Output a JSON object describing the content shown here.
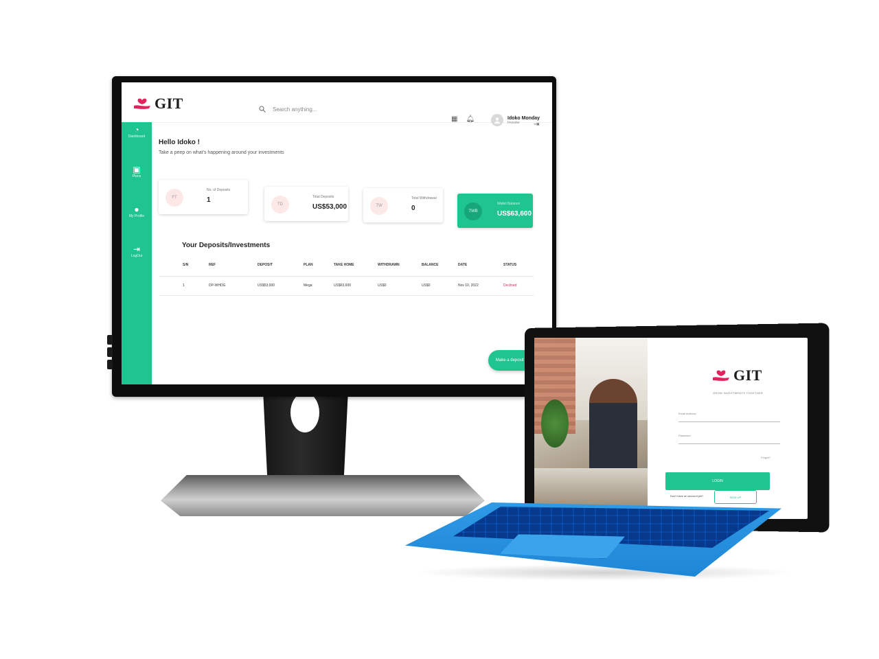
{
  "brand": {
    "name": "GIT",
    "accent": "#1fc48e",
    "logo_color": "#e0245e"
  },
  "desktop": {
    "search_placeholder": "Search anything...",
    "user": {
      "name": "Idoko Monday",
      "role": "Investor"
    },
    "sidebar": [
      {
        "label": "Dashboard",
        "icon": "gauge-icon"
      },
      {
        "label": "Plans",
        "icon": "box-icon"
      },
      {
        "label": "My Profile",
        "icon": "user-icon"
      },
      {
        "label": "LogOut",
        "icon": "logout-icon"
      }
    ],
    "greeting": "Hello Idoko !",
    "greeting_sub": "Take a peep on what's happening around your investments",
    "cards": [
      {
        "badge": "FT",
        "label": "No. of Deposits",
        "value": "1"
      },
      {
        "badge": "TD",
        "label": "Total Deposits",
        "value": "US$53,000"
      },
      {
        "badge": "TW",
        "label": "Total Withdrawal",
        "value": "0"
      },
      {
        "badge": "TWB",
        "label": "Wallet Balance",
        "value": "US$63,600"
      }
    ],
    "table_title": "Your Deposits/Investments",
    "table_headers": [
      "S/N",
      "REF",
      "DEPOSIT",
      "PLAN",
      "TAKE HOME",
      "WITHDRAWN",
      "BALANCE",
      "DATE",
      "STATUS"
    ],
    "table_rows": [
      [
        "1",
        "DP-WHDG",
        "US$53,000",
        "Mega",
        "US$63,600",
        "US$0",
        "US$0",
        "Nov 10, 2022",
        "Declined"
      ]
    ],
    "deposit_button": "Make a deposit",
    "deposit_button_icon": "+"
  },
  "tablet": {
    "tagline": "GROW INVESTMENTS TOGETHER",
    "email_placeholder": "Email Address",
    "password_placeholder": "Password",
    "forgot": "Forgot?",
    "login_button": "LOGIN",
    "no_account": "Don't have an account yet?",
    "signup_button": "SIGN UP"
  }
}
